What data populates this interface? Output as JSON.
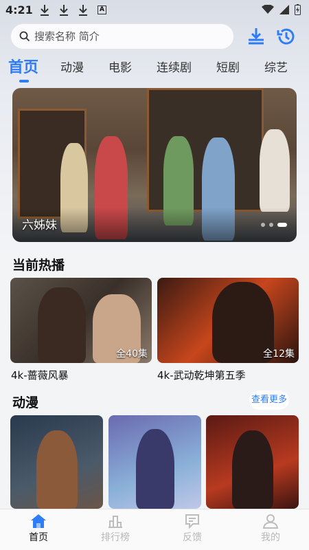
{
  "status": {
    "time": "4:21",
    "a_label": "A"
  },
  "search": {
    "placeholder": "搜索名称 简介"
  },
  "tabs": [
    "首页",
    "动漫",
    "电影",
    "连续剧",
    "短剧",
    "综艺"
  ],
  "banner": {
    "title": "六姊妹"
  },
  "hot": {
    "title": "当前热播",
    "items": [
      {
        "name": "4k-蔷薇风暴",
        "badge": "全40集"
      },
      {
        "name": "4k-武动乾坤第五季",
        "badge": "全12集"
      }
    ]
  },
  "anime": {
    "title": "动漫",
    "more": "查看更多"
  },
  "nav": [
    "首页",
    "排行榜",
    "反馈",
    "我的"
  ],
  "colors": {
    "accent": "#2e7cf6"
  }
}
